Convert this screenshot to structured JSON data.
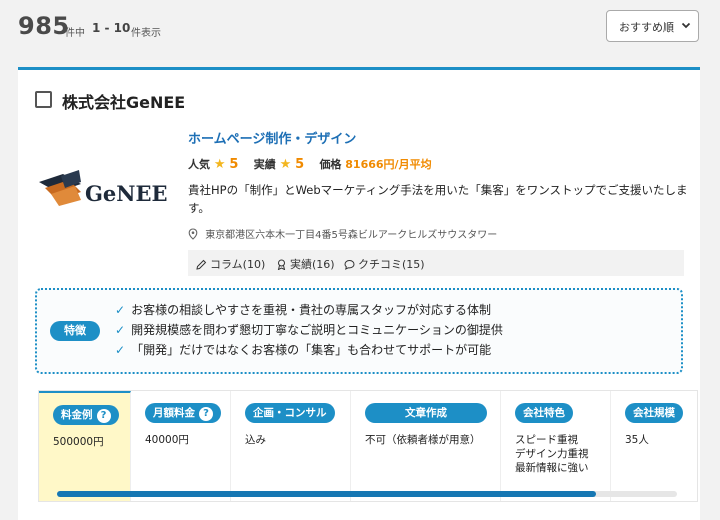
{
  "results": {
    "total": "985",
    "total_unit": "件中",
    "range": "1 - 10",
    "range_unit": "件表示"
  },
  "sort": {
    "selected": "おすすめ順",
    "icon": "chevron-down-icon"
  },
  "company": {
    "name": "株式会社GeNEE",
    "logo_text": "GeNEE",
    "service": "ホームページ制作・デザイン",
    "rating_label_popularity": "人気",
    "rating_popularity": "5",
    "rating_label_results": "実績",
    "rating_results": "5",
    "price_label": "価格",
    "price_value": "81666円/月平均",
    "description": "貴社HPの「制作」とWebマーケティング手法を用いた「集客」をワンストップでご支援いたします。",
    "address": "東京都港区六本木一丁目4番5号森ビルアークヒルズサウスタワー",
    "links": [
      {
        "label": "コラム(10)",
        "icon": "pencil-icon"
      },
      {
        "label": "実績(16)",
        "icon": "award-icon"
      },
      {
        "label": "クチコミ(15)",
        "icon": "speech-bubble-icon"
      }
    ]
  },
  "features": {
    "label": "特徴",
    "items": [
      "お客様の相談しやすさを重視・貴社の専属スタッフが対応する体制",
      "開発規模感を問わず懇切丁寧なご説明とコミュニケーションの御提供",
      "「開発」だけではなくお客様の「集客」も合わせてサポートが可能"
    ]
  },
  "pricing": [
    {
      "label": "料金例",
      "has_help": true,
      "value": [
        "500000円"
      ]
    },
    {
      "label": "月額料金",
      "has_help": true,
      "value": [
        "40000円"
      ]
    },
    {
      "label": "企画・コンサル",
      "has_help": false,
      "value": [
        "込み"
      ]
    },
    {
      "label": "文章作成",
      "has_help": false,
      "value": [
        "不可（依頼者様が用意）"
      ]
    },
    {
      "label": "会社特色",
      "has_help": false,
      "value": [
        "スピード重視",
        "デザイン力重視",
        "最新情報に強い"
      ]
    },
    {
      "label": "会社規模",
      "has_help": false,
      "value": [
        "35人"
      ]
    }
  ],
  "help_glyph": "?",
  "scroll_fraction_visible": 0.87,
  "colors": {
    "accent": "#1d8fc6",
    "price_orange": "#f08a00",
    "star": "#f3b61f",
    "highlight": "#fff8c8"
  }
}
